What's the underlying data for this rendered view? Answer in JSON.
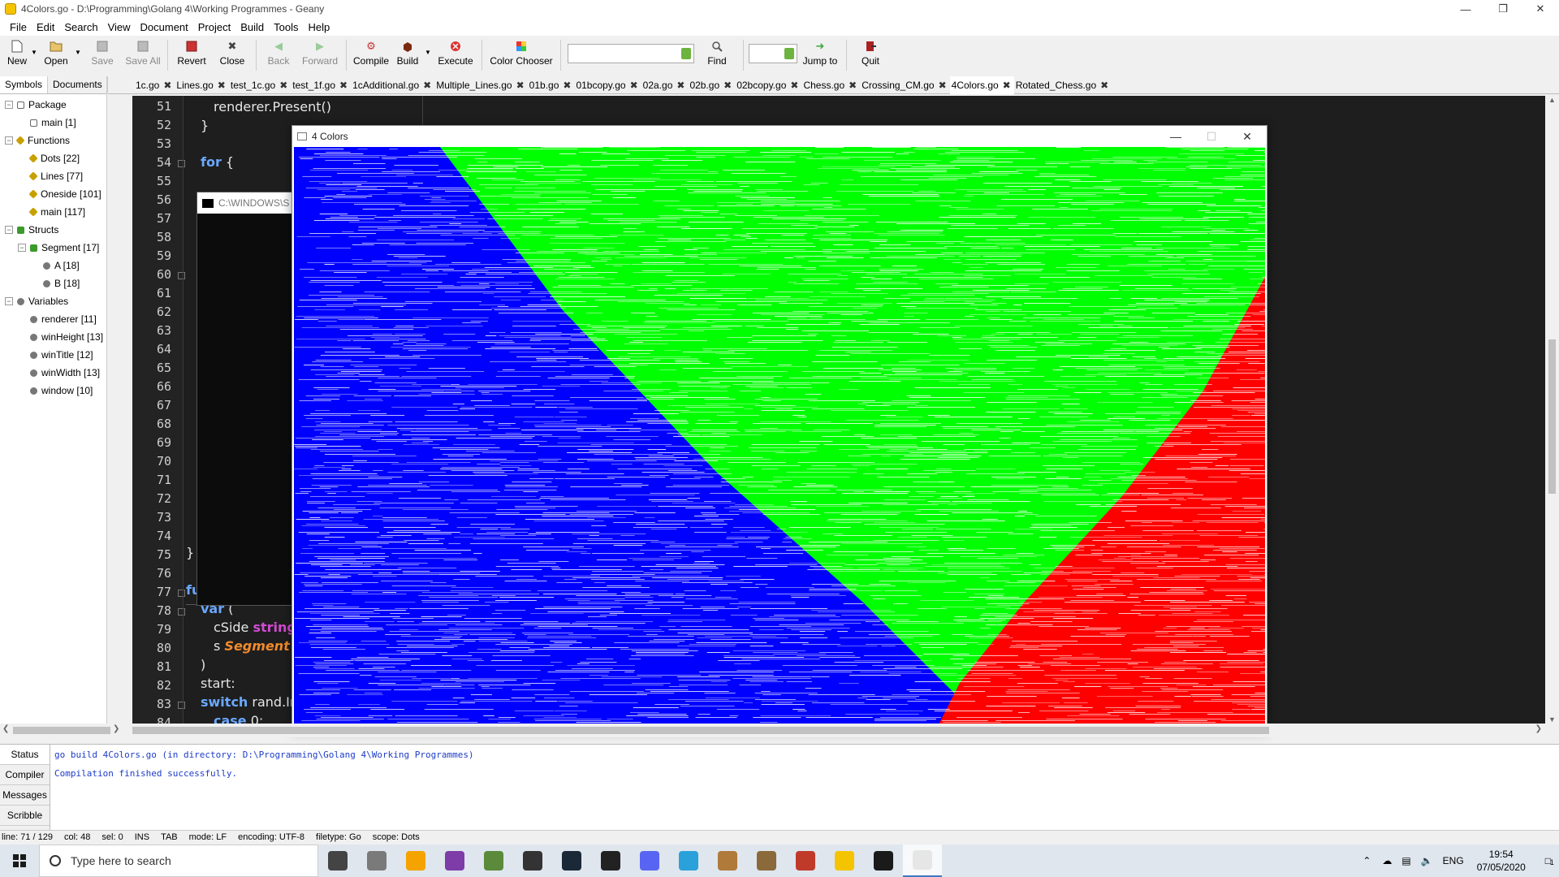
{
  "window": {
    "title": "4Colors.go - D:\\Programming\\Golang 4\\Working Programmes - Geany"
  },
  "menu": [
    "File",
    "Edit",
    "Search",
    "View",
    "Document",
    "Project",
    "Build",
    "Tools",
    "Help"
  ],
  "toolbar": {
    "new": "New",
    "open": "Open",
    "save": "Save",
    "save_all": "Save All",
    "revert": "Revert",
    "close": "Close",
    "back": "Back",
    "forward": "Forward",
    "compile": "Compile",
    "build": "Build",
    "execute": "Execute",
    "color_chooser": "Color Chooser",
    "find": "Find",
    "jump_to": "Jump to",
    "quit": "Quit",
    "search_value": "",
    "jump_value": ""
  },
  "sidebar": {
    "tabs": [
      "Symbols",
      "Documents"
    ],
    "tree": [
      {
        "label": "Package",
        "level": 0,
        "expander": "−",
        "icon": "package-icon"
      },
      {
        "label": "main [1]",
        "level": 1,
        "icon": "package-icon"
      },
      {
        "label": "Functions",
        "level": 0,
        "expander": "−",
        "icon": "function-icon"
      },
      {
        "label": "Dots [22]",
        "level": 1,
        "icon": "function-icon"
      },
      {
        "label": "Lines [77]",
        "level": 1,
        "icon": "function-icon"
      },
      {
        "label": "Oneside [101]",
        "level": 1,
        "icon": "function-icon"
      },
      {
        "label": "main [117]",
        "level": 1,
        "icon": "function-icon"
      },
      {
        "label": "Structs",
        "level": 0,
        "expander": "−",
        "icon": "struct-icon"
      },
      {
        "label": "Segment [17]",
        "level": 1,
        "expander": "−",
        "icon": "struct-icon"
      },
      {
        "label": "A [18]",
        "level": 2,
        "icon": "member-icon"
      },
      {
        "label": "B [18]",
        "level": 2,
        "icon": "member-icon"
      },
      {
        "label": "Variables",
        "level": 0,
        "expander": "−",
        "icon": "variable-icon"
      },
      {
        "label": "renderer [11]",
        "level": 1,
        "icon": "variable-icon"
      },
      {
        "label": "winHeight [13]",
        "level": 1,
        "icon": "variable-icon"
      },
      {
        "label": "winTitle [12]",
        "level": 1,
        "icon": "variable-icon"
      },
      {
        "label": "winWidth [13]",
        "level": 1,
        "icon": "variable-icon"
      },
      {
        "label": "window [10]",
        "level": 1,
        "icon": "variable-icon"
      }
    ]
  },
  "doc_tabs": [
    "1c.go",
    "Lines.go",
    "test_1c.go",
    "test_1f.go",
    "1cAdditional.go",
    "Multiple_Lines.go",
    "01b.go",
    "01bcopy.go",
    "02a.go",
    "02b.go",
    "02bcopy.go",
    "Chess.go",
    "Crossing_CM.go",
    "4Colors.go",
    "Rotated_Chess.go"
  ],
  "active_tab": "4Colors.go",
  "editor": {
    "line_numbers": [
      "51",
      "52",
      "53",
      "54",
      "55",
      "56",
      "57",
      "58",
      "59",
      "60",
      "61",
      "62",
      "63",
      "64",
      "65",
      "66",
      "67",
      "68",
      "69",
      "70",
      "71",
      "72",
      "73",
      "74",
      "75",
      "76",
      "77",
      "78",
      "79",
      "80",
      "81",
      "82",
      "83",
      "84"
    ],
    "code": {
      "l51": "renderer.Present()",
      "l52": "}",
      "l54_kw": "for",
      "l54_rest": " {",
      "l75": "}",
      "l77_kw": "fu",
      "l78_kw": "var",
      "l78_rest": " (",
      "l79_name": "cSide ",
      "l79_type": "string",
      "l80_name": "s ",
      "l80_type": "Segment",
      "l81": ")",
      "l82": "start:",
      "l83_kw": "switch",
      "l83_rest": " rand.In",
      "l84_kw": "case",
      "l84_rest": " 0:"
    }
  },
  "console_window": {
    "title": "C:\\WINDOWS\\S"
  },
  "sdl_window": {
    "title": "4 Colors",
    "colors": {
      "blue": "#0000ff",
      "green": "#00ff00",
      "red": "#ff0000",
      "white": "#ffffff"
    }
  },
  "messages": {
    "tabs": [
      "Status",
      "Compiler",
      "Messages",
      "Scribble"
    ],
    "lines": [
      "go build 4Colors.go (in directory: D:\\Programming\\Golang 4\\Working Programmes)",
      "Compilation finished successfully."
    ]
  },
  "statusbar": {
    "line": "line: 71 / 129",
    "col": "col: 48",
    "sel": "sel: 0",
    "ins": "INS",
    "tab": "TAB",
    "mode": "mode: LF",
    "encoding": "encoding: UTF-8",
    "filetype": "filetype: Go",
    "scope": "scope: Dots"
  },
  "taskbar": {
    "search_placeholder": "Type here to search",
    "apps": [
      {
        "name": "task-view",
        "color": "#444444"
      },
      {
        "name": "file-explorer",
        "color": "#7a7a7a"
      },
      {
        "name": "chrome-canary",
        "color": "#f4a300"
      },
      {
        "name": "tor-browser",
        "color": "#7d3ca8"
      },
      {
        "name": "minecraft",
        "color": "#5a8a3a"
      },
      {
        "name": "game-app",
        "color": "#333333"
      },
      {
        "name": "steam",
        "color": "#1b2838"
      },
      {
        "name": "epic-games",
        "color": "#222222"
      },
      {
        "name": "discord",
        "color": "#5865f2"
      },
      {
        "name": "telegram",
        "color": "#2aa1da"
      },
      {
        "name": "game-1",
        "color": "#b07a3a"
      },
      {
        "name": "game-2",
        "color": "#8a6a3a"
      },
      {
        "name": "game-3",
        "color": "#c03a2a"
      },
      {
        "name": "geany",
        "color": "#f5c400"
      },
      {
        "name": "command-prompt",
        "color": "#1a1a1a"
      },
      {
        "name": "sdl-app",
        "color": "#e6e6e6"
      }
    ],
    "lang": "ENG",
    "time": "19:54",
    "date": "07/05/2020",
    "notification_count": "1"
  }
}
